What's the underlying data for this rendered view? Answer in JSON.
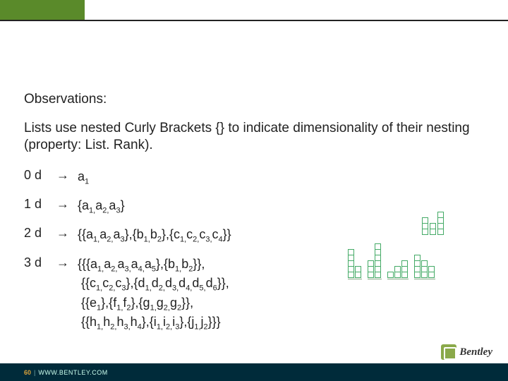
{
  "header": {
    "title": ""
  },
  "obs": {
    "title": "Observations:",
    "desc": "Lists use nested Curly Brackets {} to indicate dimensionality of their nesting (property: List. Rank)."
  },
  "rows": {
    "r0": {
      "dim": "0 d",
      "arrow": "→",
      "expr_html": "a<span class='sub'>1</span>"
    },
    "r1": {
      "dim": "1 d",
      "arrow": "→",
      "expr_html": "{a<span class='sub'>1,</span>a<span class='sub'>2,</span>a<span class='sub'>3</span>}"
    },
    "r2": {
      "dim": "2 d",
      "arrow": "→",
      "expr_html": "{{a<span class='sub'>1,</span>a<span class='sub'>2,</span>a<span class='sub'>3</span>},{b<span class='sub'>1,</span>b<span class='sub'>2</span>},{c<span class='sub'>1,</span>c<span class='sub'>2,</span>c<span class='sub'>3,</span>c<span class='sub'>4</span>}}"
    },
    "r3": {
      "dim": "3 d",
      "arrow": "→",
      "expr_html": "{{{a<span class='sub'>1,</span>a<span class='sub'>2,</span>a<span class='sub'>3,</span>a<span class='sub'>4,</span>a<span class='sub'>5</span>},{b<span class='sub'>1,</span>b<span class='sub'>2</span>}},<br>&nbsp;{{c<span class='sub'>1,</span>c<span class='sub'>2,</span>c<span class='sub'>3</span>},{d<span class='sub'>1,</span>d<span class='sub'>2,</span>d<span class='sub'>3,</span>d<span class='sub'>4,</span>d<span class='sub'>5,</span>d<span class='sub'>6</span>}},<br>&nbsp;{{e<span class='sub'>1</span>},{f<span class='sub'>1,</span>f<span class='sub'>2</span>},{g<span class='sub'>1,</span>g<span class='sub'>2,</span>g<span class='sub'>2</span>}},<br>&nbsp;{{h<span class='sub'>1,</span>h<span class='sub'>2,</span>h<span class='sub'>3,</span>h<span class='sub'>4</span>},{i<span class='sub'>1,</span>i<span class='sub'>2,</span>i<span class='sub'>3</span>},{j<span class='sub'>1,</span>j<span class='sub'>2</span>}}}"
    }
  },
  "chart_data": {
    "d2": {
      "type": "bar",
      "structure": [
        3,
        2,
        4
      ],
      "note": "column heights = list lengths"
    },
    "d3": {
      "type": "bar",
      "structure": [
        [
          5,
          2
        ],
        [
          3,
          6
        ],
        [
          1,
          2,
          3
        ],
        [
          4,
          3,
          2
        ]
      ],
      "note": "grouped columns, heights = inner list lengths"
    }
  },
  "footer": {
    "page": "60",
    "sep": "|",
    "url": "WWW.BENTLEY.COM"
  },
  "logo": {
    "text": "Bentley"
  }
}
